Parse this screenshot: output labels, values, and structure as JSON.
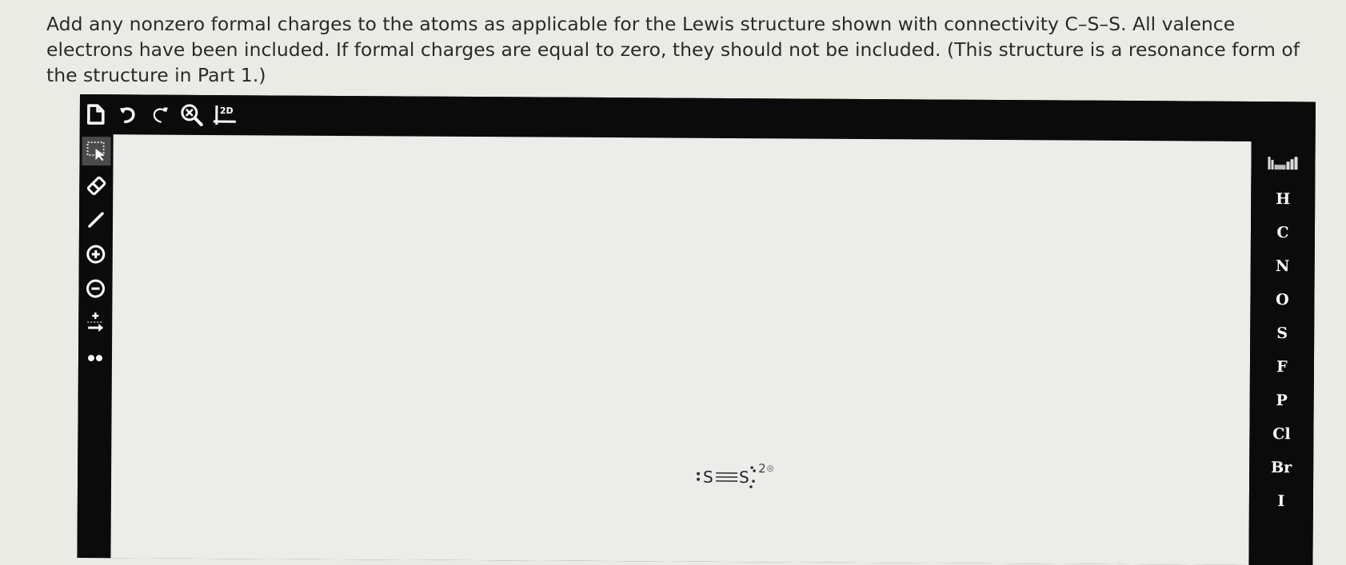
{
  "question": {
    "text": "Add any nonzero formal charges to the atoms as applicable for the Lewis structure shown with connectivity C–S–S. All valence electrons have been included. If formal charges are equal to zero, they should not be included. (This structure is a resonance form of the structure in Part 1.)"
  },
  "toolbar": {
    "new_icon": "new-document-icon",
    "undo_icon": "undo-icon",
    "redo_icon": "redo-icon",
    "zoom_icon": "zoom-clear-icon",
    "clean_icon": "clean-2d-icon",
    "clean_label": "2D"
  },
  "left_tools": [
    {
      "name": "select-icon"
    },
    {
      "name": "eraser-icon"
    },
    {
      "name": "bond-icon"
    },
    {
      "name": "plus-charge-icon"
    },
    {
      "name": "minus-charge-icon"
    },
    {
      "name": "radical-arrow-icon"
    },
    {
      "name": "lone-pair-icon"
    }
  ],
  "elements": {
    "periodic_icon": "periodic-table-icon",
    "list": [
      "H",
      "C",
      "N",
      "O",
      "S",
      "F",
      "P",
      "Cl",
      "Br",
      "I"
    ]
  },
  "molecule": {
    "atom1": "S",
    "atom2": "S",
    "charge": "2"
  },
  "colors": {
    "toolbar_bg": "#0b0b0b",
    "canvas_bg": "#ececea",
    "page_bg": "#ebebe6",
    "icon": "#ffffff"
  }
}
